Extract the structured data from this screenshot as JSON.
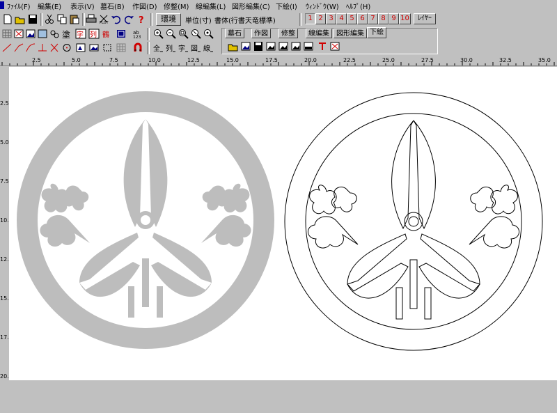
{
  "menu": [
    {
      "label": "ﾌｧｲﾙ(F)"
    },
    {
      "label": "編集(E)"
    },
    {
      "label": "表示(V)"
    },
    {
      "label": "墓石(B)"
    },
    {
      "label": "作図(D)"
    },
    {
      "label": "修整(M)"
    },
    {
      "label": "線編集(L)"
    },
    {
      "label": "図形編集(C)"
    },
    {
      "label": "下絵(I)"
    },
    {
      "label": "ｳｨﾝﾄﾞｳ(W)"
    },
    {
      "label": "ﾍﾙﾌﾟ(H)"
    }
  ],
  "toolbar": {
    "env_label": "環境",
    "unit_label": "単位(寸)",
    "font_label": "書体(行書天竜標準)",
    "layers": [
      "1",
      "2",
      "3",
      "4",
      "5",
      "6",
      "7",
      "8",
      "9",
      "10"
    ],
    "layer_button": "ﾚｲﾔｰ"
  },
  "tabs": [
    "墓石",
    "作図",
    "修整",
    "線編集",
    "図形編集",
    "下絵"
  ],
  "active_tab": "下絵",
  "ruler_labels": [
    "2.5",
    "5.0",
    "7.5",
    "10.0",
    "12.5",
    "15.0",
    "17.5",
    "20.0",
    "22.5",
    "25.0",
    "27.5",
    "30.0",
    "32.5",
    "35.0"
  ],
  "vruler_labels": [
    "2.5",
    "5.0",
    "7.5",
    "10.0",
    "12.5",
    "15.0",
    "17.5",
    "20.0"
  ],
  "icons": {
    "file_toolbar": [
      "new-file-icon",
      "open-icon",
      "save-icon",
      "cut-icon",
      "copy-icon",
      "paste-icon",
      "print-icon",
      "plot-icon",
      "undo-icon",
      "redo-icon",
      "help-icon"
    ],
    "tool_row1": [
      "grid-icon",
      "select-icon",
      "image-icon",
      "frame-icon",
      "shape-icon",
      "fill-icon",
      "stroke-icon",
      "text-icon",
      "pattern-icon",
      "zoom-in-icon",
      "zoom-out-icon",
      "zoom-area-icon",
      "zoom-fit-icon",
      "zoom-all-icon"
    ],
    "tool_row2": [
      "line-icon",
      "polyline-icon",
      "curve-icon",
      "perpendicular-icon",
      "cross-icon",
      "circle-icon",
      "mirror-icon",
      "rect-icon",
      "region-icon",
      "magnet-icon",
      "char-size-icon",
      "column-icon",
      "char-icon",
      "square-icon",
      "line-text-icon"
    ],
    "tab_tools": [
      "open-image-icon",
      "load-image-icon",
      "save-image-icon",
      "image-a-icon",
      "image-b-icon",
      "image-c-icon",
      "image-d-icon",
      "trace-icon",
      "clear-image-icon"
    ]
  },
  "colors": {
    "gray": "#c0c0c0",
    "emblem_fill": "#bdbdbd",
    "red": "#d00000"
  }
}
